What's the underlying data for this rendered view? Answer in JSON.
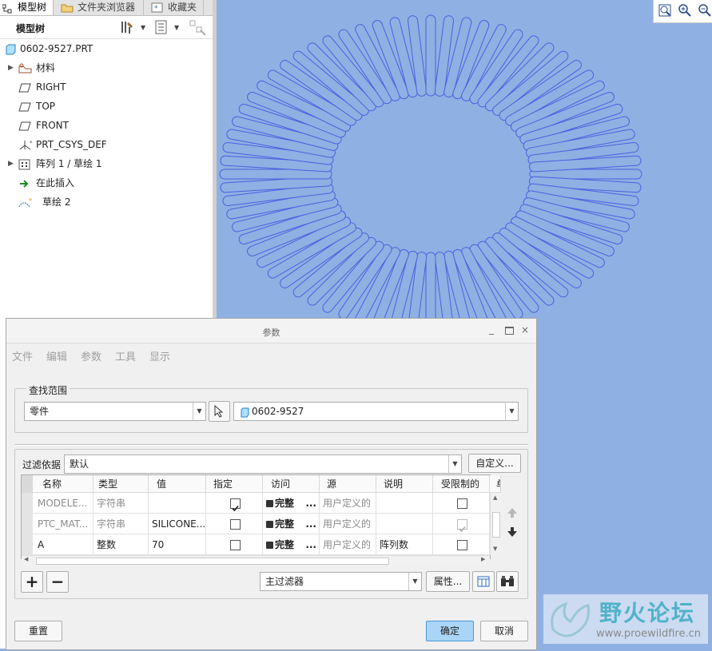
{
  "tabs": [
    {
      "label": "模型树"
    },
    {
      "label": "文件夹浏览器"
    },
    {
      "label": "收藏夹"
    }
  ],
  "tree": {
    "header": "模型树",
    "root": "0602-9527.PRT",
    "items": [
      {
        "label": "材料",
        "expandable": true
      },
      {
        "label": "RIGHT",
        "expandable": false
      },
      {
        "label": "TOP",
        "expandable": false
      },
      {
        "label": "FRONT",
        "expandable": false
      },
      {
        "label": "PRT_CSYS_DEF",
        "expandable": false
      },
      {
        "label": "阵列 1 / 草绘 1",
        "expandable": true
      },
      {
        "label": "在此插入",
        "expandable": false
      },
      {
        "label": "草绘 2",
        "expandable": false
      }
    ]
  },
  "dialog": {
    "title": "参数",
    "menu": [
      "文件",
      "编辑",
      "参数",
      "工具",
      "显示"
    ],
    "scope_group_label": "查找范围",
    "scope_value": "零件",
    "object_value": "0602-9527",
    "filter_label": "过滤依据",
    "filter_value": "默认",
    "customize_label": "自定义...",
    "columns": [
      "名称",
      "类型",
      "值",
      "指定",
      "访问",
      "源",
      "说明",
      "受限制的",
      "单"
    ],
    "rows": [
      {
        "name": "MODELE...",
        "type": "字符串",
        "value": "",
        "designate": true,
        "access": "完整",
        "source": "用户定义的",
        "desc": "",
        "restricted": false,
        "restricted_disabled": false,
        "grey": true
      },
      {
        "name": "PTC_MAT...",
        "type": "字符串",
        "value": "SILICONE...",
        "designate": false,
        "access": "完整",
        "source": "用户定义的",
        "desc": "",
        "restricted": true,
        "restricted_disabled": true,
        "grey": true
      },
      {
        "name": "A",
        "type": "整数",
        "value": "70",
        "designate": false,
        "access": "完整",
        "source": "用户定义的",
        "desc": "阵列数",
        "restricted": false,
        "restricted_disabled": false,
        "grey": false
      }
    ],
    "access_ellipsis": "...",
    "add_label": "+",
    "remove_label": "−",
    "main_filter_value": "主过滤器",
    "properties_label": "属性...",
    "reset_label": "重置",
    "ok_label": "确定",
    "cancel_label": "取消"
  },
  "watermark": {
    "title": "野火论坛",
    "url": "www.proewildfire.cn"
  },
  "colors": {
    "graphics_bg": "#8fb0e2",
    "sketch_line": "#4a5fe0",
    "ok_button": "#aad5f6"
  },
  "sketch": {
    "slot_count": 72
  }
}
